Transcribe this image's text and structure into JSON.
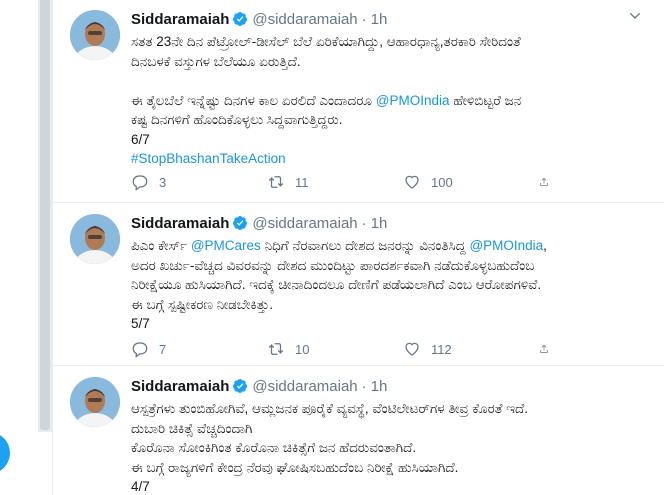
{
  "tweets": [
    {
      "name": "Siddaramaiah",
      "handle": "@siddaramaiah",
      "dot": "·",
      "time": "1h",
      "lines": [
        {
          "text": "ಸತತ 23ನೇ ದಿನ ಪೆಟ್ರೋಲ್-ಡೀಸೆಲ್ ಬೆಲೆ ಏರಿಕೆಯಾಗಿದ್ದು, ಆಹಾರಧಾನ್ಯ,ತರಕಾರಿ ಸೇರಿದಂತೆ"
        },
        {
          "text": "ದಿನಬಳಕೆ ವಸ್ತುಗಳ ಬೆಲೆಯೂ ಏರುತ್ತಿದೆ."
        },
        {
          "text": ""
        },
        {
          "pre": "ಈ ತೈಲಬೆಲೆ ಇನ್ನೆಷ್ಟು ದಿನಗಳ ಕಾಲ ಏರಲಿದೆ ಎಂದಾದರೂ ",
          "mention": "@PMOIndia",
          "post": " ಹೇಳಿಬಿಟ್ಟರೆ ಜನ"
        },
        {
          "text": "ಕಷ್ಟ ದಿನಗಳಿಗೆ ಹೊಂದಿಕೊಳ್ಳಲು ಸಿದ್ದವಾಗುತ್ತಿದ್ದರು."
        },
        {
          "text": "6/7"
        },
        {
          "hashtag": "#StopBhashanTakeAction"
        }
      ],
      "replies": "3",
      "retweets": "11",
      "likes": "100"
    },
    {
      "name": "Siddaramaiah",
      "handle": "@siddaramaiah",
      "dot": "·",
      "time": "1h",
      "lines": [
        {
          "pre": "ಪಿಎಂ ಕೇರ್ಸ್ ",
          "mention": "@PMCares",
          "mid": " ನಿಧಿಗೆ ನೆರವಾಗಲು ದೇಶದ ಜನರನ್ನು ವಿನಂತಿಸಿದ್ದ ",
          "mention2": "@PMOIndia",
          "post": ","
        },
        {
          "text": "ಅದರ ಖರ್ಚು-ವೆಚ್ಚದ ವಿವರವನ್ನು ದೇಶದ ಮುಂದಿಟ್ಟು ಪಾರದರ್ಶಕವಾಗಿ ನಡೆದುಕೊಳ್ಳಬಹುದೆಂಬ"
        },
        {
          "text": "ನಿರೀಕ್ಷೆಯೂ ಹುಸಿಯಾಗಿದೆ. ಇದಕ್ಕೆ ಚೀನಾದಿಂದಲೂ ದೇಣಿಗೆ ಪಡೆಯಲಾಗಿದೆ ಎಂಬ ಆರೋಪಗಳಿವೆ."
        },
        {
          "text": "ಈ ಬಗ್ಗೆ ಸ್ಪಷ್ಟೀಕರಣ ನೀಡಬೇಕಿತ್ತು."
        },
        {
          "text": "5/7"
        }
      ],
      "replies": "7",
      "retweets": "10",
      "likes": "112"
    },
    {
      "name": "Siddaramaiah",
      "handle": "@siddaramaiah",
      "dot": "·",
      "time": "1h",
      "lines": [
        {
          "text": "ಆಸ್ಪತ್ರೆಗಳು ತುಂಬಿಹೋಗಿವೆ, ಆಮ್ಲಜನಕ ಪೂರೈಕೆ ವ್ಯವಸ್ಥೆ, ವೆಂಟಿಲೇಟರ್‌ಗಳ ತೀವ್ರ ಕೊರತೆ ಇದೆ."
        },
        {
          "text": "ದುಬಾರಿ ಚಿಕಿತ್ಸೆ ವೆಚ್ಚದಿಂದಾಗಿ"
        },
        {
          "text": "ಕೊರೊನಾ ಸೋಂಕಿಗಿಂತ ಕೊರೊನಾ ಚಿಕಿತ್ಸೆಗೆ ಜನ ಹೆದರುವಂತಾಗಿದೆ."
        },
        {
          "text": "ಈ ಬಗ್ಗೆ ರಾಜ್ಯಗಳಿಗೆ ಕೇಂದ್ರ ನೆರವು ಘೋಷಿಸಬಹುದೆಂಬ ನಿರೀಕ್ಷೆ ಹುಸಿಯಾಗಿದೆ."
        },
        {
          "text": "4/7"
        }
      ]
    }
  ],
  "icons": {
    "verified": "verified-badge-icon",
    "caret": "chevron-down-icon",
    "reply": "reply-icon",
    "retweet": "retweet-icon",
    "like": "heart-icon",
    "share": "share-icon"
  },
  "colors": {
    "link": "#1b95e0",
    "verified": "#1da1f2",
    "muted": "#657786"
  }
}
